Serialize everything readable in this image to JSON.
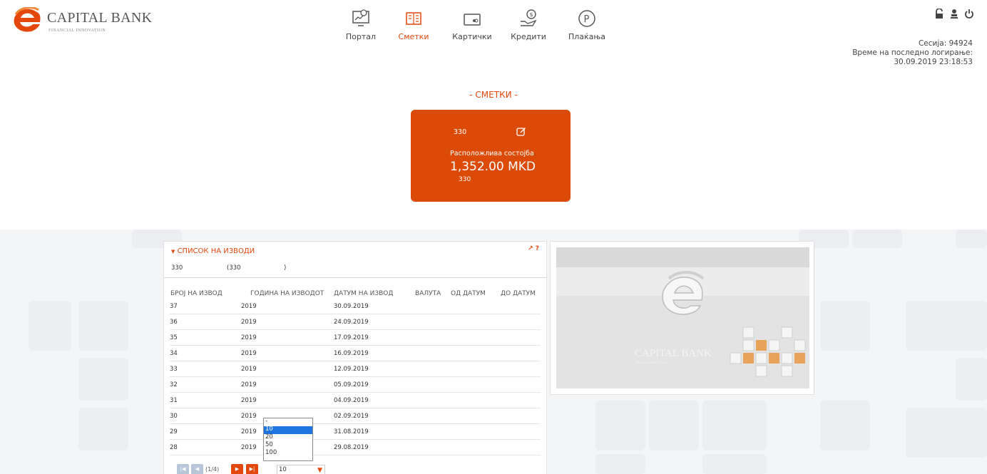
{
  "header": {
    "brand_name": "CAPITAL BANK",
    "brand_tagline": "FINANCIAL INNOVATION",
    "nav": [
      {
        "label": "Портал",
        "icon": "portal-icon",
        "active": false
      },
      {
        "label": "Сметки",
        "icon": "accounts-icon",
        "active": true
      },
      {
        "label": "Картички",
        "icon": "card-icon",
        "active": false
      },
      {
        "label": "Кредити",
        "icon": "loan-icon",
        "active": false
      },
      {
        "label": "Плаќања",
        "icon": "payment-icon",
        "active": false
      }
    ],
    "session_label": "Сесија: 94924",
    "last_login_label": "Време на последно логирање:",
    "last_login_value": "30.09.2019 23:18:53"
  },
  "accounts": {
    "section_title": "- СМЕТКИ -",
    "card": {
      "account_number": "330",
      "balance_label": "Расположлива состојба",
      "balance": "1,352.00 MKD",
      "sub_number": "330"
    }
  },
  "statements": {
    "title": "СПИСОК НА ИЗВОДИ",
    "tools": "↗ ?",
    "account_number": "330",
    "account_name_open": "(330",
    "account_name_close": ")",
    "columns": [
      "БРОЈ НА ИЗВОД",
      "ГОДИНА НА ИЗВОДОТ",
      "ДАТУМ НА ИЗВОД",
      "ВАЛУТА",
      "ОД ДАТУМ",
      "ДО ДАТУМ"
    ],
    "rows": [
      {
        "num": "37",
        "year": "2019",
        "date": "30.09.2019"
      },
      {
        "num": "36",
        "year": "2019",
        "date": "24.09.2019"
      },
      {
        "num": "35",
        "year": "2019",
        "date": "17.09.2019"
      },
      {
        "num": "34",
        "year": "2019",
        "date": "16.09.2019"
      },
      {
        "num": "33",
        "year": "2019",
        "date": "12.09.2019"
      },
      {
        "num": "32",
        "year": "2019",
        "date": "05.09.2019"
      },
      {
        "num": "31",
        "year": "2019",
        "date": "04.09.2019"
      },
      {
        "num": "30",
        "year": "2019",
        "date": "02.09.2019"
      },
      {
        "num": "29",
        "year": "2019",
        "date": "31.08.2019"
      },
      {
        "num": "28",
        "year": "2019",
        "date": "29.08.2019"
      }
    ],
    "pager": {
      "info": "(1/4)",
      "page_size": "10",
      "page_size_options": [
        "-",
        "10",
        "20",
        "50",
        "100"
      ]
    }
  },
  "promo": {
    "brand_name": "CAPITAL BANK",
    "brand_tagline": "FINANCIAL INNOVATION"
  },
  "colors": {
    "accent": "#e3470b",
    "card": "#dc4a07",
    "selected_option": "#1e74e0"
  }
}
